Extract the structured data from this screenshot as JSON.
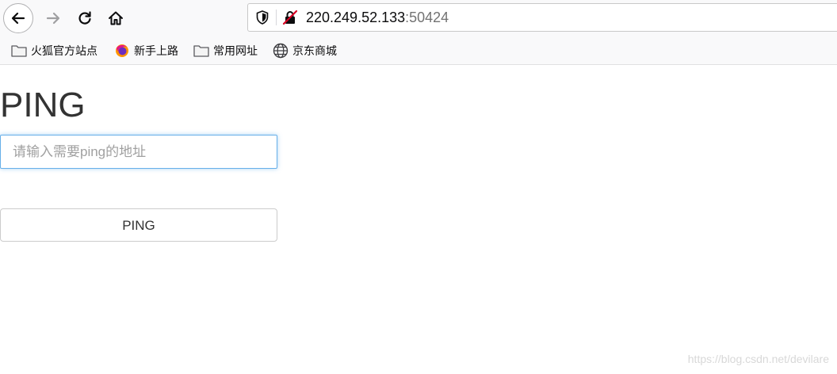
{
  "browser": {
    "url_host": "220.249.52.133",
    "url_port": ":50424",
    "icons": {
      "back": "back-arrow-icon",
      "forward": "forward-arrow-icon",
      "reload": "reload-icon",
      "home": "home-icon",
      "shield": "shield-icon",
      "insecure": "insecure-connection-icon"
    }
  },
  "bookmarks": {
    "items": [
      {
        "label": "火狐官方站点",
        "icon": "folder-icon"
      },
      {
        "label": "新手上路",
        "icon": "firefox-icon"
      },
      {
        "label": "常用网址",
        "icon": "folder-icon"
      },
      {
        "label": "京东商城",
        "icon": "globe-icon"
      }
    ]
  },
  "page": {
    "heading": "PING",
    "input_placeholder": "请输入需要ping的地址",
    "input_value": "",
    "button_label": "PING",
    "accent_color": "#66afe9"
  },
  "watermark": "https://blog.csdn.net/devilare"
}
